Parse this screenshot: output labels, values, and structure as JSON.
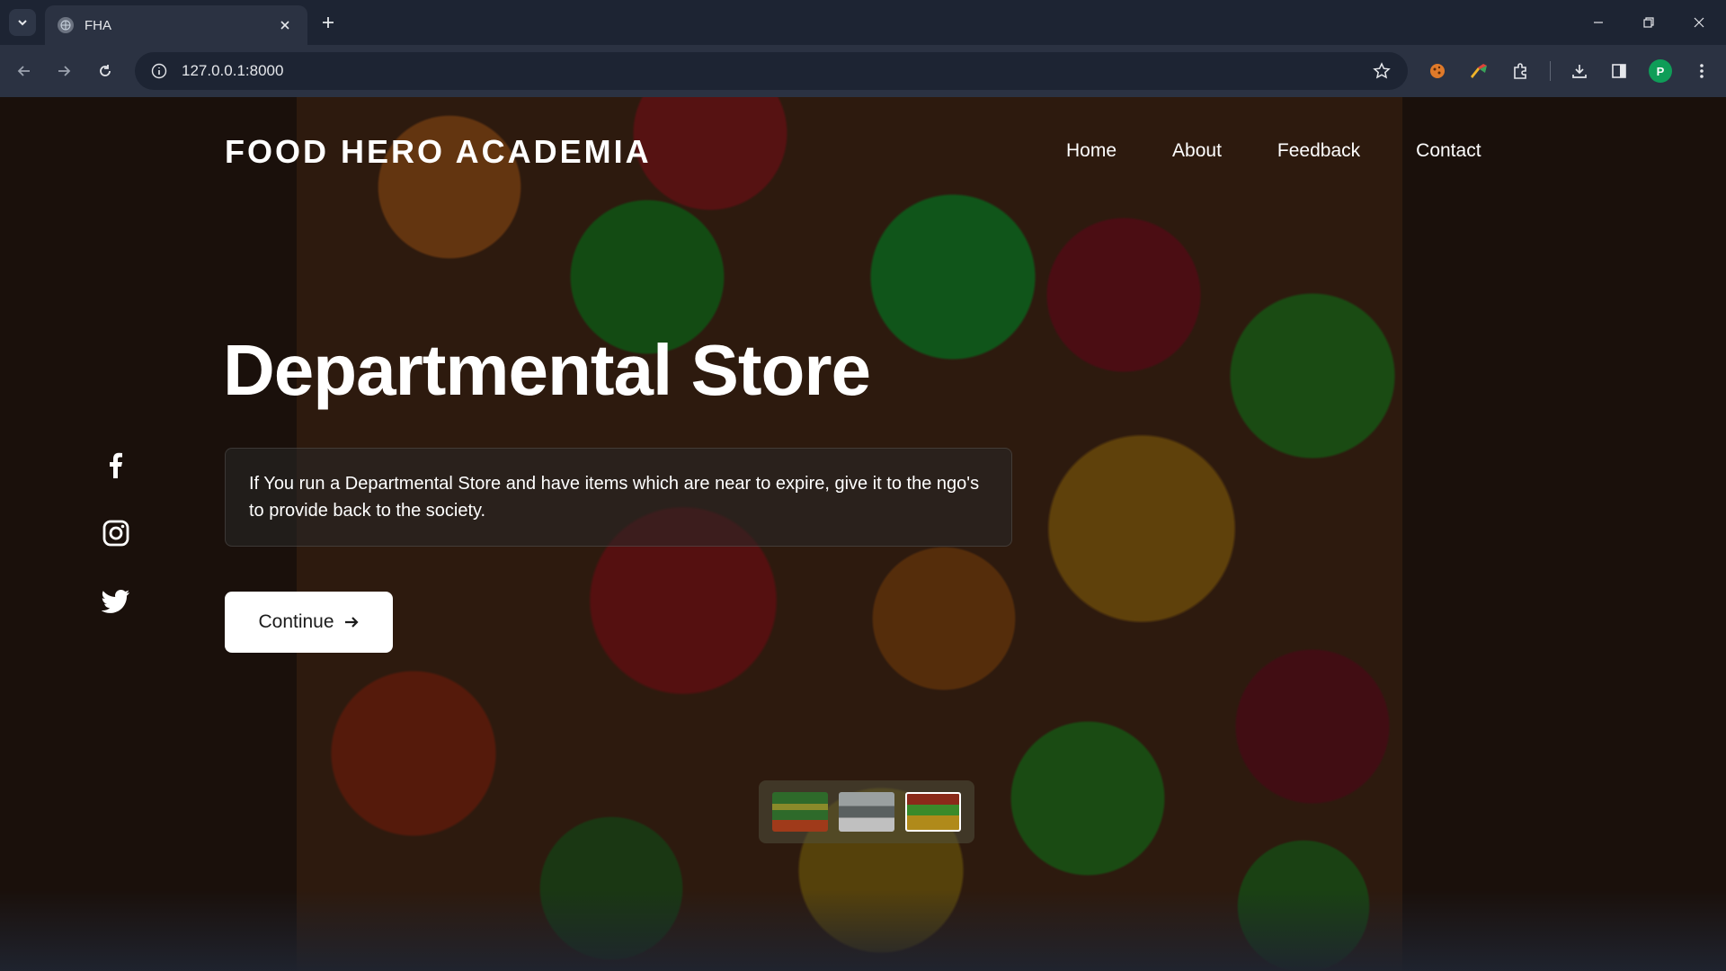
{
  "browser": {
    "tab_title": "FHA",
    "url": "127.0.0.1:8000",
    "profile_initial": "P"
  },
  "site": {
    "brand": "FOOD HERO ACADEMIA",
    "nav": [
      "Home",
      "About",
      "Feedback",
      "Contact"
    ]
  },
  "hero": {
    "title": "Departmental Store",
    "description": "If You run a Departmental Store and have items which are near to expire, give it to the ngo's to provide back to the society.",
    "cta_label": "Continue"
  },
  "social": [
    "facebook-icon",
    "instagram-icon",
    "twitter-icon"
  ],
  "carousel": {
    "thumb_count": 3,
    "active_index": 2
  },
  "colors": {
    "chrome_dark": "#1d2433",
    "chrome_mid": "#2b3242",
    "profile": "#0f9d58"
  }
}
